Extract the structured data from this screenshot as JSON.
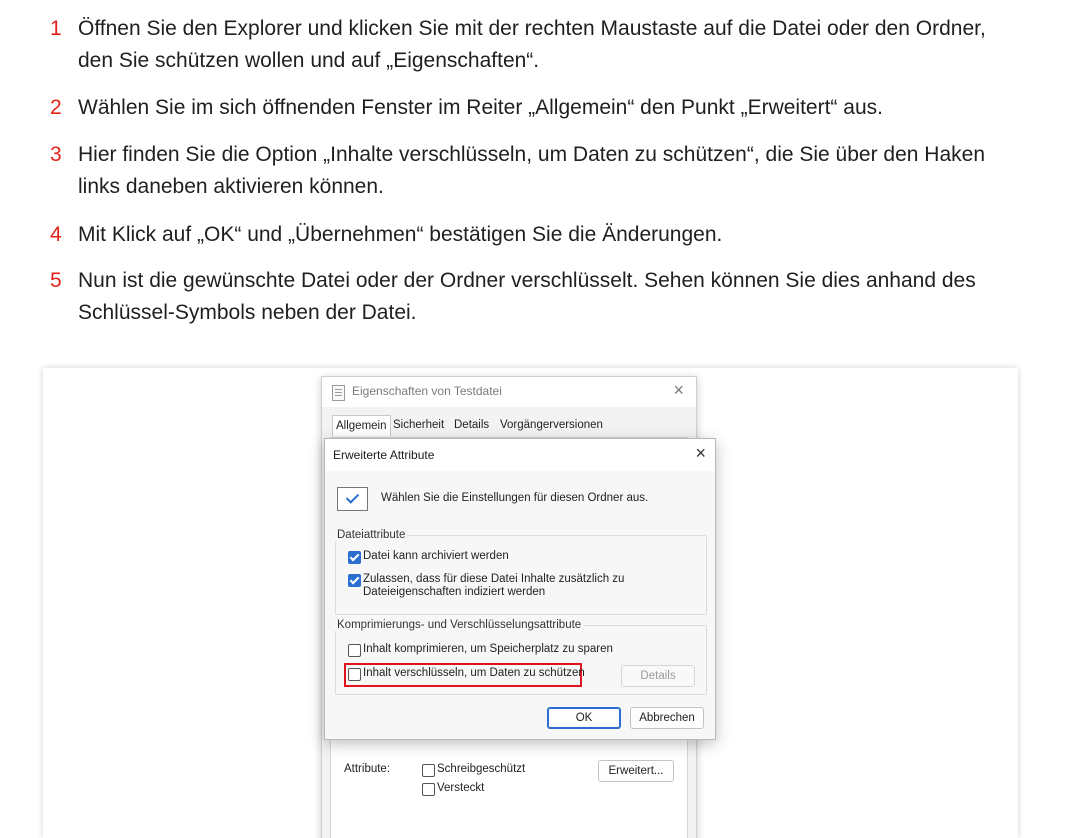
{
  "steps": [
    {
      "num": "1",
      "text": "Öffnen Sie den Explorer und klicken Sie mit der rechten Maustaste auf die Datei oder den Ordner, den Sie schützen wollen und auf „Eigenschaften“."
    },
    {
      "num": "2",
      "text": "Wählen Sie im sich öffnenden Fenster im Reiter „Allgemein“ den Punkt „Erweitert“ aus."
    },
    {
      "num": "3",
      "text": "Hier finden Sie die Option „Inhalte verschlüsseln, um Daten zu schützen“, die Sie über den Haken links daneben aktivieren können."
    },
    {
      "num": "4",
      "text": "Mit Klick auf „OK“ und „Übernehmen“ bestätigen Sie die Änderungen."
    },
    {
      "num": "5",
      "text": "Nun ist die gewünschte Datei oder der Ordner verschlüsselt. Sehen können Sie dies anhand des Schlüssel-Symbols neben der Datei."
    }
  ],
  "colors": {
    "accent": "#e2231a",
    "checkbox_blue": "#2a6fcf",
    "highlight_red": "#e0141e"
  },
  "properties_window": {
    "title": "Eigenschaften von Testdatei",
    "close_icon": "×",
    "tabs": [
      "Allgemein",
      "Sicherheit",
      "Details",
      "Vorgängerversionen"
    ],
    "active_tab": "Allgemein",
    "attributes_label": "Attribute:",
    "readonly_label": "Schreibgeschützt",
    "hidden_label": "Versteckt",
    "advanced_button": "Erweitert..."
  },
  "advanced_dialog": {
    "title": "Erweiterte Attribute",
    "close_icon": "×",
    "intro": "Wählen Sie die Einstellungen für diesen Ordner aus.",
    "file_attributes": {
      "label": "Dateiattribute",
      "archive": {
        "label": "Datei kann archiviert werden",
        "checked": true
      },
      "index": {
        "label_line1": "Zulassen, dass für diese Datei Inhalte zusätzlich zu",
        "label_line2": "Dateieigenschaften indiziert werden",
        "checked": true
      }
    },
    "compression_encryption": {
      "label": "Komprimierungs- und Verschlüsselungsattribute",
      "compress": {
        "label": "Inhalt komprimieren, um Speicherplatz zu sparen",
        "checked": false
      },
      "encrypt": {
        "label": "Inhalt verschlüsseln, um Daten zu schützen",
        "checked": false
      },
      "details_button": "Details"
    },
    "ok_button": "OK",
    "cancel_button": "Abbrechen"
  }
}
